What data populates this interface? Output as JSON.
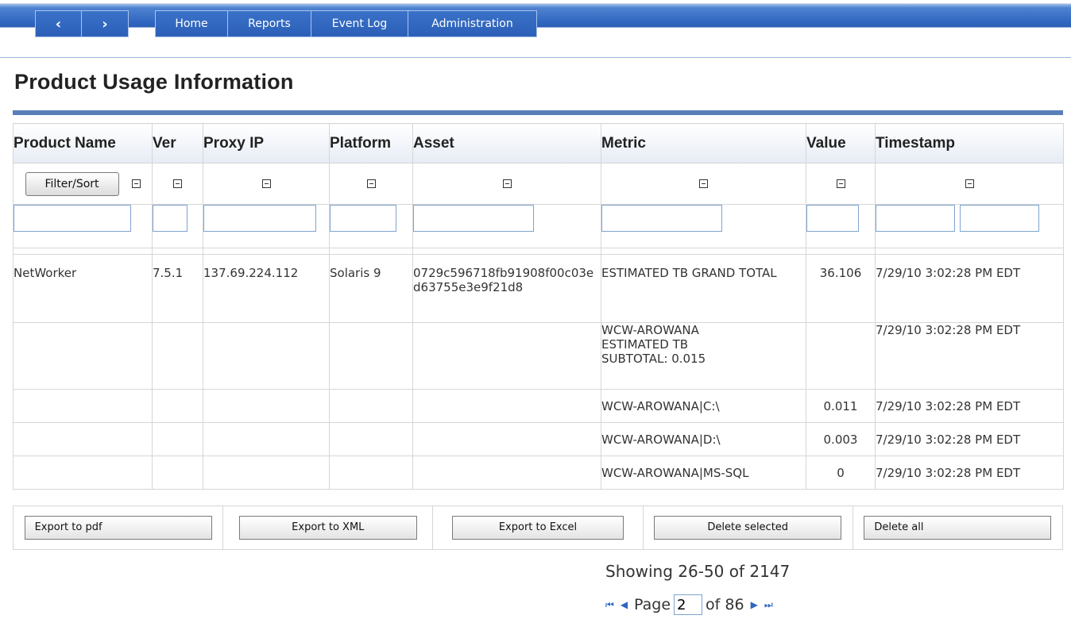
{
  "nav": {
    "back_glyph": "‹",
    "forward_glyph": "›",
    "items": [
      {
        "label": "Home"
      },
      {
        "label": "Reports"
      },
      {
        "label": "Event Log"
      },
      {
        "label": "Administration"
      }
    ]
  },
  "page": {
    "title": "Product Usage Information"
  },
  "table": {
    "columns": [
      "Product Name",
      "Ver",
      "Proxy IP",
      "Platform",
      "Asset",
      "Metric",
      "Value",
      "Timestamp"
    ],
    "filter_sort_label": "Filter/Sort",
    "rows": [
      {
        "product": "NetWorker",
        "ver": "7.5.1",
        "proxy_ip": "137.69.224.112",
        "platform": "Solaris 9",
        "asset": "0729c596718fb91908f00c03ed63755e3e9f21d8",
        "metric": "ESTIMATED TB GRAND TOTAL",
        "value": "36.106",
        "timestamp": "7/29/10 3:02:28 PM EDT"
      },
      {
        "product": "",
        "ver": "",
        "proxy_ip": "",
        "platform": "",
        "asset": "",
        "metric": "WCW-AROWANA ESTIMATED TB SUBTOTAL: 0.015",
        "value": "",
        "timestamp": "7/29/10 3:02:28 PM EDT"
      },
      {
        "product": "",
        "ver": "",
        "proxy_ip": "",
        "platform": "",
        "asset": "",
        "metric": "WCW-AROWANA|C:\\",
        "value": "0.011",
        "timestamp": "7/29/10 3:02:28 PM EDT"
      },
      {
        "product": "",
        "ver": "",
        "proxy_ip": "",
        "platform": "",
        "asset": "",
        "metric": "WCW-AROWANA|D:\\",
        "value": "0.003",
        "timestamp": "7/29/10 3:02:28 PM EDT"
      },
      {
        "product": "",
        "ver": "",
        "proxy_ip": "",
        "platform": "",
        "asset": "",
        "metric": "WCW-AROWANA|MS-SQL",
        "value": "0",
        "timestamp": "7/29/10 3:02:28 PM EDT"
      }
    ]
  },
  "export": {
    "pdf": "Export to pdf",
    "xml": "Export to XML",
    "excel": "Export to Excel",
    "delete_selected": "Delete selected",
    "delete_all": "Delete all"
  },
  "pagination": {
    "showing": "Showing 26-50 of 2147",
    "page_label": "Page",
    "current_page": "2",
    "of_label": "of 86"
  }
}
